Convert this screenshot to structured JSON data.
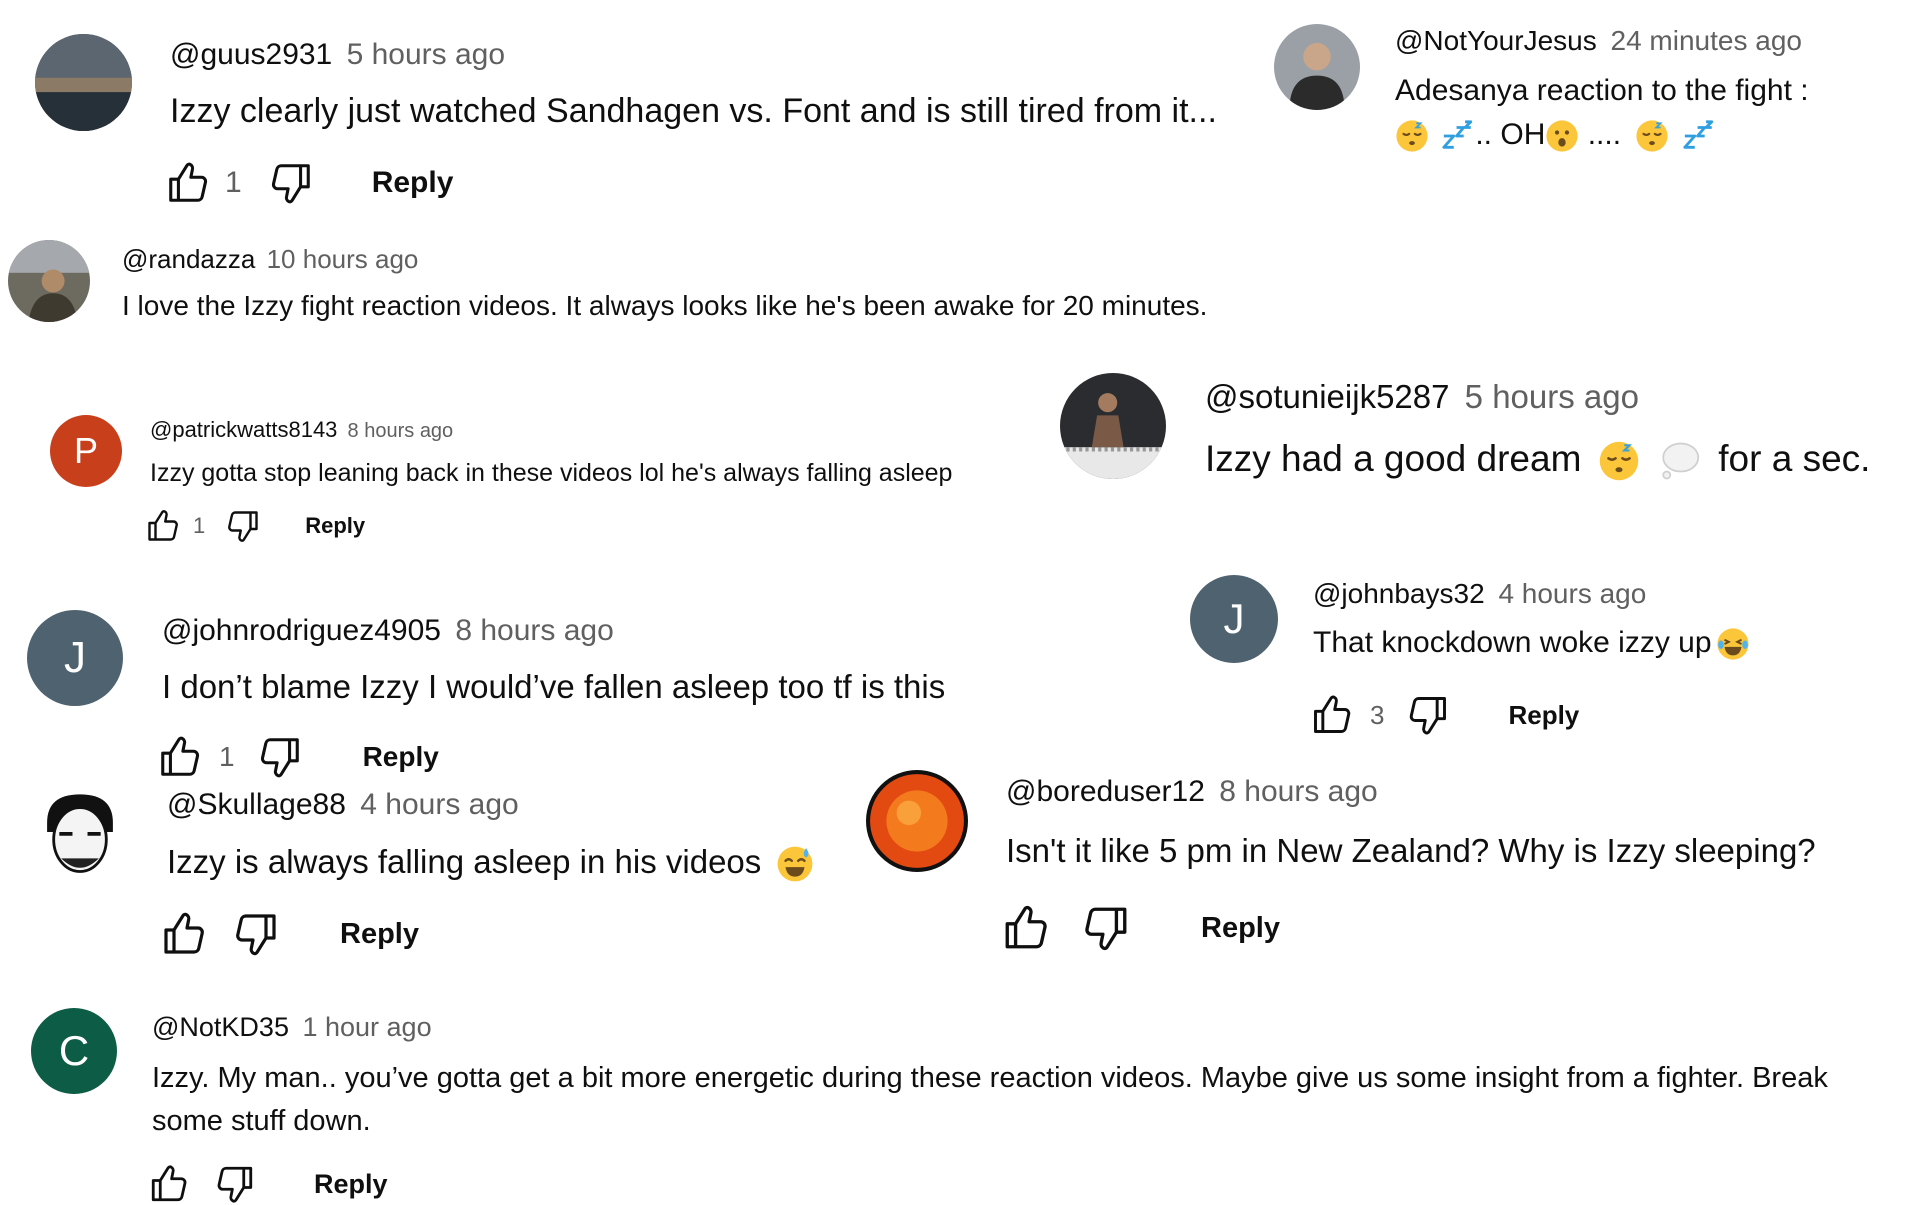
{
  "comments": [
    {
      "author": "@guus2931",
      "time": "5 hours ago",
      "text": "Izzy clearly just watched Sandhagen vs. Font and is still tired from it...",
      "likes": "1",
      "reply": "Reply"
    },
    {
      "author": "@NotYourJesus",
      "time": "24 minutes ago",
      "text_line1": "Adesanya reaction to the fight :",
      "text_line2_a": "..",
      "text_line2_b": "OH",
      "text_line2_c": "...."
    },
    {
      "author": "@randazza",
      "time": "10 hours ago",
      "text": "I love the Izzy fight reaction videos. It always looks like he's been awake for 20 minutes."
    },
    {
      "author": "@patrickwatts8143",
      "time": "8 hours ago",
      "avatar_letter": "P",
      "text": "Izzy gotta stop leaning back in these videos lol he's always falling asleep",
      "likes": "1",
      "reply": "Reply"
    },
    {
      "author": "@sotunieijk5287",
      "time": "5 hours ago",
      "text_a": "Izzy had a good dream",
      "text_b": "for a sec."
    },
    {
      "author": "@johnrodriguez4905",
      "time": "8 hours ago",
      "avatar_letter": "J",
      "text": "I don’t blame Izzy I would’ve fallen asleep too tf is this",
      "likes": "1",
      "reply": "Reply"
    },
    {
      "author": "@johnbays32",
      "time": "4 hours ago",
      "avatar_letter": "J",
      "text": "That knockdown woke izzy up",
      "likes": "3",
      "reply": "Reply"
    },
    {
      "author": "@Skullage88",
      "time": "4 hours ago",
      "text": "Izzy is always falling asleep in his videos",
      "reply": "Reply"
    },
    {
      "author": "@boreduser12",
      "time": "8 hours ago",
      "text": "Isn't it like 5 pm in New Zealand? Why is Izzy sleeping?",
      "reply": "Reply"
    },
    {
      "author": "@NotKD35",
      "time": "1 hour ago",
      "avatar_letter": "C",
      "text_line1": "Izzy. My man.. you’ve gotta get a bit more energetic during these reaction videos. Maybe give us some insight from a fighter. Break",
      "text_line2": "some stuff down.",
      "reply": "Reply"
    }
  ],
  "colors": {
    "avatar_p": "#c8401b",
    "avatar_j": "#4f6270",
    "avatar_c": "#0d5c45",
    "time": "#606060",
    "text": "#0f0f0f"
  },
  "icons": [
    "thumbs-up-icon",
    "thumbs-down-icon",
    "sleeping-face-emoji",
    "zzz-emoji",
    "astonished-face-emoji",
    "thought-bubble-emoji",
    "laughing-face-emoji",
    "sweat-smile-emoji"
  ]
}
